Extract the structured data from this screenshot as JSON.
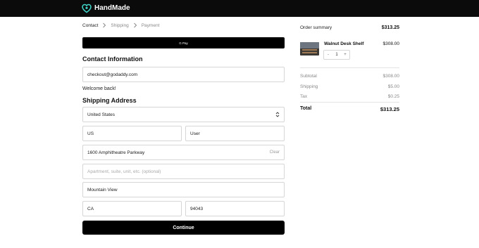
{
  "header": {
    "brand": "HandMade",
    "logo_icon": "handmade-logo-icon"
  },
  "breadcrumb": {
    "items": [
      "Contact",
      "Shipping",
      "Payment"
    ],
    "active": "Contact"
  },
  "express": {
    "gpay_label": "G Pay"
  },
  "contact": {
    "title": "Contact Information",
    "email": "checkout@godaddy.com",
    "welcome": "Welcome back!"
  },
  "shipping": {
    "title": "Shipping Address",
    "country": "United States",
    "first_name": "US",
    "last_name": "User",
    "address1": "1600 Amphitheatre Parkway",
    "clear_label": "Clear",
    "address2_placeholder": "Apartment, suite, unit, etc. (optional)",
    "city": "Mountain View",
    "state": "CA",
    "zip": "94043"
  },
  "actions": {
    "continue_label": "Continue"
  },
  "summary": {
    "title": "Order summary",
    "total_top": "$313.25",
    "item": {
      "name": "Walnut Desk Shelf",
      "price": "$308.00",
      "qty": "1",
      "minus": "-",
      "plus": "+"
    },
    "rows": [
      {
        "label": "Subtotal",
        "value": "$308.00"
      },
      {
        "label": "Shipping",
        "value": "$5.00"
      },
      {
        "label": "Tax",
        "value": "$0.25"
      }
    ],
    "total_label": "Total",
    "total_value": "$313.25"
  },
  "colors": {
    "topbar": "#0b0b0b",
    "accent": "#000000",
    "logo": "#3fd3c6"
  }
}
